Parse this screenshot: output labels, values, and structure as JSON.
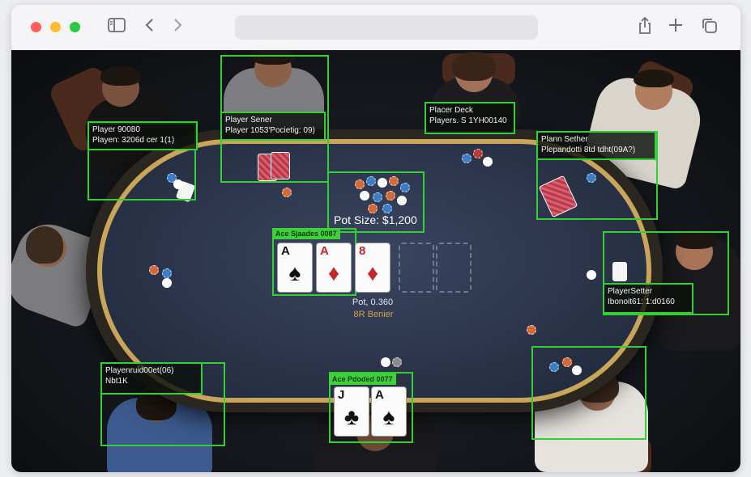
{
  "window": {
    "controls": {
      "close_color": "#ff5f57",
      "minimize_color": "#febc2e",
      "zoom_color": "#28c840"
    },
    "toolbar_icons": [
      "sidebar-icon",
      "back-chevron-icon",
      "forward-chevron-icon",
      "share-icon",
      "new-tab-plus-icon",
      "tabs-overview-icon"
    ],
    "address_bar_text": ""
  },
  "colors": {
    "detection_box": "#33d035",
    "felt": "#2a3348",
    "rail_gold": "#c9a55a"
  },
  "detections": {
    "top_left": {
      "line1": "Player 90080",
      "line2": "Playen: 3206d cer 1(1)"
    },
    "top_center_left": {
      "line1": "Player Sener",
      "line2": "Player 1053'Pocietig: 09)"
    },
    "top_center_right": {
      "line1": "Placer Deck",
      "line2": "Players. S 1YH00140"
    },
    "top_right": {
      "line1": "Plann Sether",
      "line2": "Plepandotti 8td tdht(09A?)"
    },
    "right": {
      "line1": "PlayerSetter",
      "line2": "Ibonoit61: 1:d0160"
    },
    "bottom_left": {
      "line1": "Playenruid00et(06)",
      "line2": "Nbt1K"
    },
    "community_tag": "Ace Sjaades 0087",
    "player_hand_tag": "Ace Pdoded 0077"
  },
  "pot": {
    "label": "Pot Size: $1,200"
  },
  "center_info": {
    "line1": "Pot, 0.360",
    "line2": "8R Benier"
  },
  "community_cards": [
    {
      "rank": "A",
      "suit": "♠",
      "color": "#111111"
    },
    {
      "rank": "A",
      "suit": "♦",
      "color": "#c9262c"
    },
    {
      "rank": "8",
      "suit": "♦",
      "color": "#c9262c"
    }
  ],
  "player_hand": [
    {
      "rank": "J",
      "suit": "♣",
      "color": "#111111"
    },
    {
      "rank": "A",
      "suit": "♠",
      "color": "#111111"
    }
  ]
}
